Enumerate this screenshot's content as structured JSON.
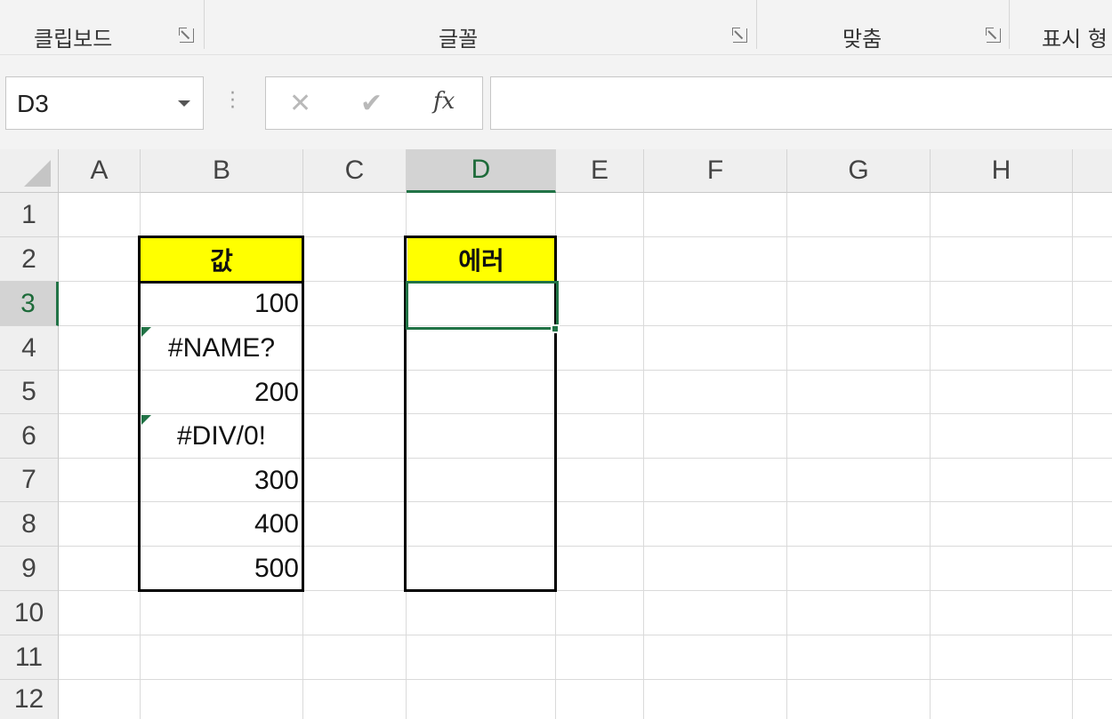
{
  "ribbon": {
    "groups": [
      {
        "label": "클립보드"
      },
      {
        "label": "글꼴"
      },
      {
        "label": "맞춤"
      },
      {
        "label": "표시 형"
      }
    ]
  },
  "formula_bar": {
    "name_box": "D3",
    "cancel_glyph": "✕",
    "enter_glyph": "✔",
    "fx_label": "fx",
    "formula": ""
  },
  "sheet": {
    "columns": [
      "A",
      "B",
      "C",
      "D",
      "E",
      "F",
      "G",
      "H"
    ],
    "selected_column": "D",
    "rows": [
      "1",
      "2",
      "3",
      "4",
      "5",
      "6",
      "7",
      "8",
      "9",
      "10",
      "11",
      "12"
    ],
    "selected_row": "3",
    "active_cell": "D3",
    "accent_color": "#217346",
    "header_fill_color": "#ffff00",
    "table_value": {
      "header": "값",
      "cells": [
        "100",
        "#NAME?",
        "200",
        "#DIV/0!",
        "300",
        "400",
        "500"
      ]
    },
    "table_error": {
      "header": "에러",
      "cells": [
        "",
        "",
        "",
        "",
        "",
        "",
        ""
      ]
    }
  }
}
